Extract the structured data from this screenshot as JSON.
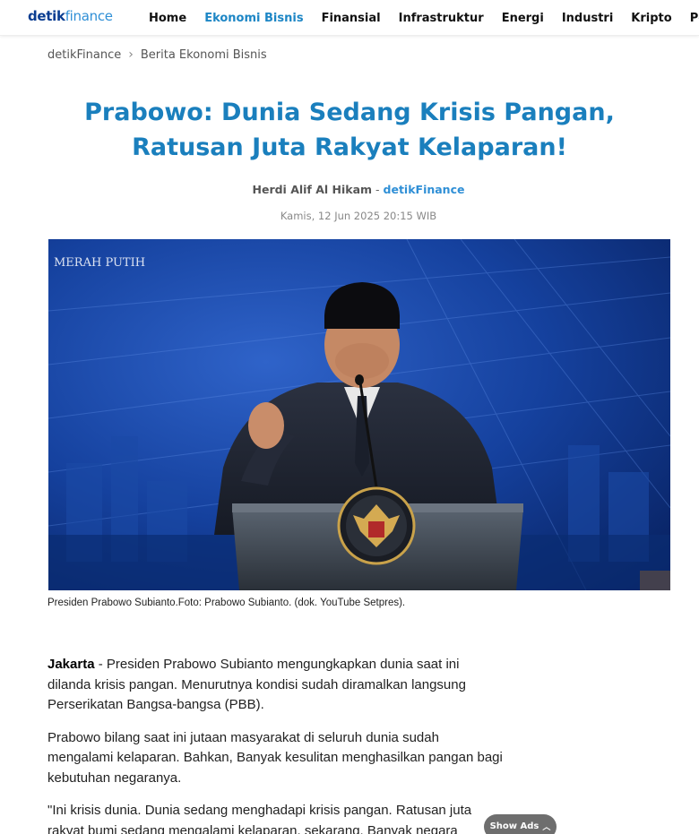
{
  "header": {
    "logo_bold": "detik",
    "logo_light": "finance",
    "nav": [
      "Home",
      "Ekonomi Bisnis",
      "Finansial",
      "Infrastruktur",
      "Energi",
      "Industri",
      "Kripto",
      "Perencanaan"
    ],
    "active_nav": "Ekonomi Bisnis"
  },
  "breadcrumb": {
    "items": [
      "detikFinance",
      "Berita Ekonomi Bisnis"
    ]
  },
  "article": {
    "title": "Prabowo: Dunia Sedang Krisis Pangan, Ratusan Juta Rakyat Kelaparan!",
    "author": "Herdi Alif Al Hikam",
    "separator": " - ",
    "source": "detikFinance",
    "date": "Kamis, 12 Jun 2025 20:15 WIB",
    "photo_watermark": "MERAH PUTIH",
    "caption": "Presiden Prabowo Subianto.Foto: Prabowo Subianto. (dok. YouTube Setpres).",
    "lead_location": "Jakarta",
    "lead_text": " - Presiden Prabowo Subianto mengungkapkan dunia saat ini dilanda krisis pangan. Menurutnya kondisi sudah diramalkan langsung Perserikatan Bangsa-bangsa (PBB).",
    "paragraph2": "Prabowo bilang saat ini jutaan masyarakat di seluruh dunia sudah mengalami kelaparan. Bahkan, Banyak kesulitan menghasilkan pangan bagi kebutuhan negaranya.",
    "paragraph3": "\"Ini krisis dunia. Dunia sedang menghadapi krisis pangan. Ratusan juta rakyat bumi sedang mengalami kelaparan, sekarang. Banyak negara"
  },
  "ads": {
    "show_label": "Show Ads"
  }
}
